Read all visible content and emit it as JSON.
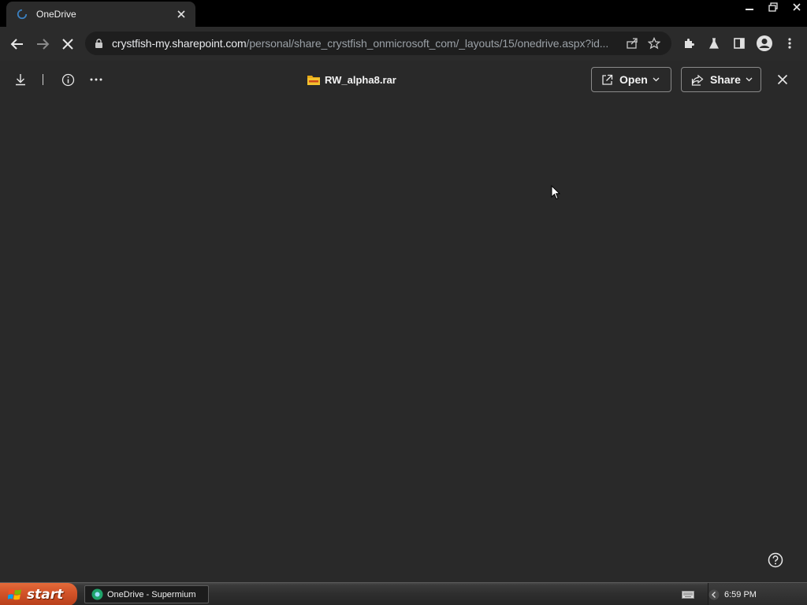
{
  "browser": {
    "tab": {
      "title": "OneDrive"
    },
    "url": {
      "host": "crystfish-my.sharepoint.com",
      "path": "/personal/share_crystfish_onmicrosoft_com/_layouts/15/onedrive.aspx?id..."
    }
  },
  "viewer": {
    "file_name": "RW_alpha8.rar",
    "open_label": "Open",
    "share_label": "Share"
  },
  "taskbar": {
    "start_label": "start",
    "task_label": "OneDrive - Supermium",
    "clock": "6:59 PM"
  },
  "colors": {
    "viewer_bg": "#292929",
    "chrome_bg": "#2b2b2b",
    "start_orange": "#d4552a",
    "rar_yellow": "#f2c12e"
  },
  "icons": {
    "tab_favicon": "onedrive-icon",
    "stop": "close-x-icon",
    "download": "download-icon",
    "info": "info-icon",
    "more": "ellipsis-icon"
  }
}
